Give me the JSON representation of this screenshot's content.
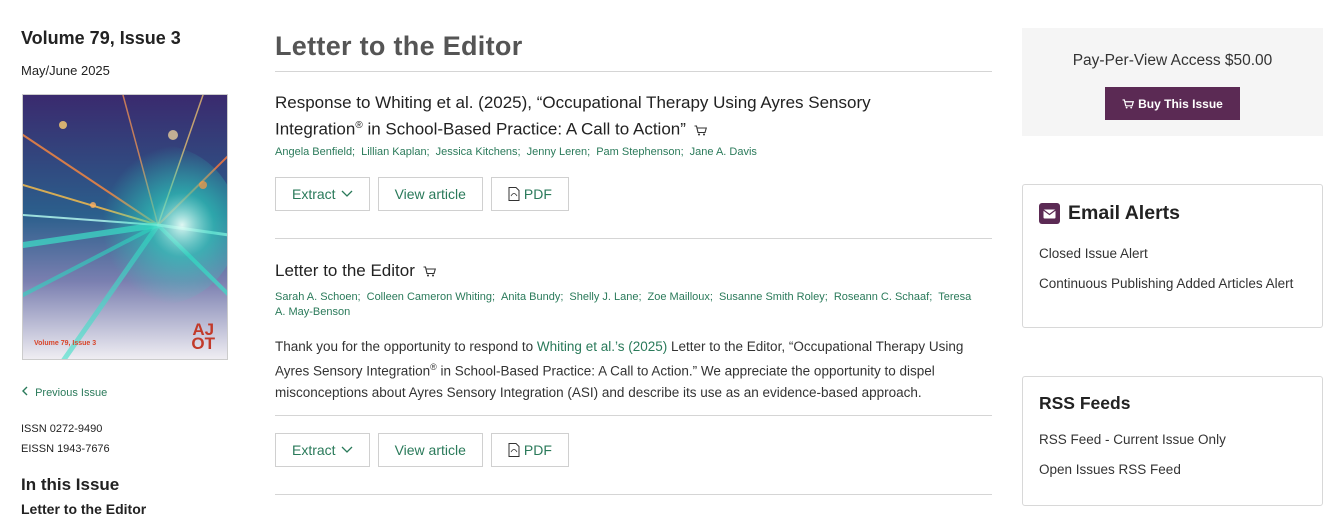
{
  "sidebar": {
    "volume": "Volume 79, Issue 3",
    "date": "May/June 2025",
    "cover_label": "Volume 79, Issue 3",
    "cover_logo_top": "AJ",
    "cover_logo_bottom": "OT",
    "previous_issue": "Previous Issue",
    "issn": "ISSN 0272-9490",
    "eissn": "EISSN 1943-7676",
    "in_this_issue": "In this Issue",
    "in_this_issue_item": "Letter to the Editor"
  },
  "main": {
    "section_title": "Letter to the Editor",
    "articles": [
      {
        "title_line1": "Response to Whiting et al. (2025), “Occupational Therapy Using Ayres Sensory",
        "title_line2_pre": "Integration",
        "title_sup": "®",
        "title_line2_post": " in School-Based Practice: A Call to Action”",
        "authors": [
          "Angela Benfield;",
          "Lillian Kaplan;",
          "Jessica Kitchens;",
          "Jenny Leren;",
          "Pam Stephenson;",
          "Jane A. Davis"
        ],
        "extract_label": "Extract",
        "view_label": "View article",
        "pdf_label": "PDF"
      },
      {
        "title": "Letter to the Editor",
        "authors": [
          "Sarah A. Schoen;",
          "Colleen Cameron Whiting;",
          "Anita Bundy;",
          "Shelly J. Lane;",
          "Zoe Mailloux;",
          "Susanne Smith Roley;",
          "Roseann C. Schaaf;",
          "Teresa A. May-Benson"
        ],
        "abstract_pre": "Thank you for the opportunity to respond to ",
        "abstract_link": "Whiting et al.’s (2025)",
        "abstract_mid": " Letter to the Editor, “Occupational Therapy Using Ayres Sensory Integration",
        "abstract_sup": "®",
        "abstract_post": " in School-Based Practice: A Call to Action.” We appreciate the opportunity to dispel misconceptions about Ayres Sensory Integration (ASI) and describe its use as an evidence-based approach.",
        "extract_label": "Extract",
        "view_label": "View article",
        "pdf_label": "PDF"
      }
    ]
  },
  "right": {
    "ppv_text": "Pay-Per-View Access $50.00",
    "buy_label": "Buy This Issue",
    "email_title": "Email Alerts",
    "email_links": [
      "Closed Issue Alert",
      "Continuous Publishing Added Articles Alert"
    ],
    "rss_title": "RSS Feeds",
    "rss_links": [
      "RSS Feed - Current Issue Only",
      "Open Issues RSS Feed"
    ]
  },
  "colors": {
    "link_green": "#2a7a5a",
    "brand_purple": "#5b2a54"
  }
}
